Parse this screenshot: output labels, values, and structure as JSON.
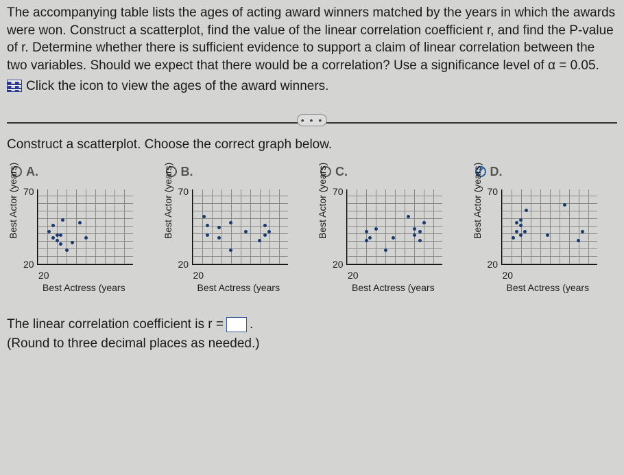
{
  "problem_text": "The accompanying table lists the ages of acting award winners matched by the years in which the awards were won. Construct a scatterplot, find the value of the linear correlation coefficient r, and find the P-value of r. Determine whether there is sufficient evidence to support a claim of linear correlation between the two variables. Should we expect that there would be a correlation? Use a significance level of α = 0.05.",
  "icon_link_text": "Click the icon to view the ages of the award winners.",
  "ellipsis": "• • •",
  "scatter_prompt": "Construct a scatterplot. Choose the correct graph below.",
  "options": {
    "a": "A.",
    "b": "B.",
    "c": "C.",
    "d": "D."
  },
  "axis": {
    "ylabel": "Best Actor (years)",
    "xlabel": "Best Actress (years",
    "ymax": "70",
    "ymin": "20",
    "xmin": "20"
  },
  "answer_prefix": "The linear correlation coefficient is r =",
  "answer_suffix": ".",
  "hint": "(Round to three decimal places as needed.)",
  "chart_data": [
    {
      "type": "scatter",
      "option": "A",
      "xlabel": "Best Actress (years)",
      "ylabel": "Best Actor (years)",
      "xlim": [
        20,
        70
      ],
      "ylim": [
        20,
        70
      ],
      "points": [
        [
          26,
          42
        ],
        [
          28,
          38
        ],
        [
          28,
          46
        ],
        [
          30,
          36
        ],
        [
          30,
          40
        ],
        [
          32,
          34
        ],
        [
          32,
          40
        ],
        [
          33,
          50
        ],
        [
          35,
          30
        ],
        [
          38,
          35
        ],
        [
          42,
          48
        ],
        [
          45,
          38
        ]
      ]
    },
    {
      "type": "scatter",
      "option": "B",
      "xlabel": "Best Actress (years)",
      "ylabel": "Best Actor (years)",
      "xlim": [
        20,
        70
      ],
      "ylim": [
        20,
        70
      ],
      "points": [
        [
          26,
          52
        ],
        [
          28,
          46
        ],
        [
          28,
          40
        ],
        [
          34,
          38
        ],
        [
          34,
          45
        ],
        [
          40,
          48
        ],
        [
          40,
          30
        ],
        [
          48,
          42
        ],
        [
          55,
          36
        ],
        [
          58,
          40
        ],
        [
          58,
          46
        ],
        [
          60,
          42
        ]
      ]
    },
    {
      "type": "scatter",
      "option": "C",
      "xlabel": "Best Actress (years)",
      "ylabel": "Best Actor (years)",
      "xlim": [
        20,
        70
      ],
      "ylim": [
        20,
        70
      ],
      "points": [
        [
          30,
          36
        ],
        [
          30,
          42
        ],
        [
          32,
          38
        ],
        [
          35,
          44
        ],
        [
          40,
          30
        ],
        [
          44,
          38
        ],
        [
          52,
          52
        ],
        [
          55,
          40
        ],
        [
          55,
          44
        ],
        [
          58,
          42
        ],
        [
          58,
          36
        ],
        [
          60,
          48
        ]
      ]
    },
    {
      "type": "scatter",
      "option": "D",
      "xlabel": "Best Actress (years)",
      "ylabel": "Best Actor (years)",
      "xlim": [
        20,
        70
      ],
      "ylim": [
        20,
        70
      ],
      "points": [
        [
          26,
          38
        ],
        [
          28,
          42
        ],
        [
          28,
          48
        ],
        [
          30,
          46
        ],
        [
          30,
          50
        ],
        [
          30,
          40
        ],
        [
          32,
          42
        ],
        [
          33,
          56
        ],
        [
          44,
          40
        ],
        [
          53,
          60
        ],
        [
          60,
          36
        ],
        [
          62,
          42
        ]
      ]
    }
  ]
}
